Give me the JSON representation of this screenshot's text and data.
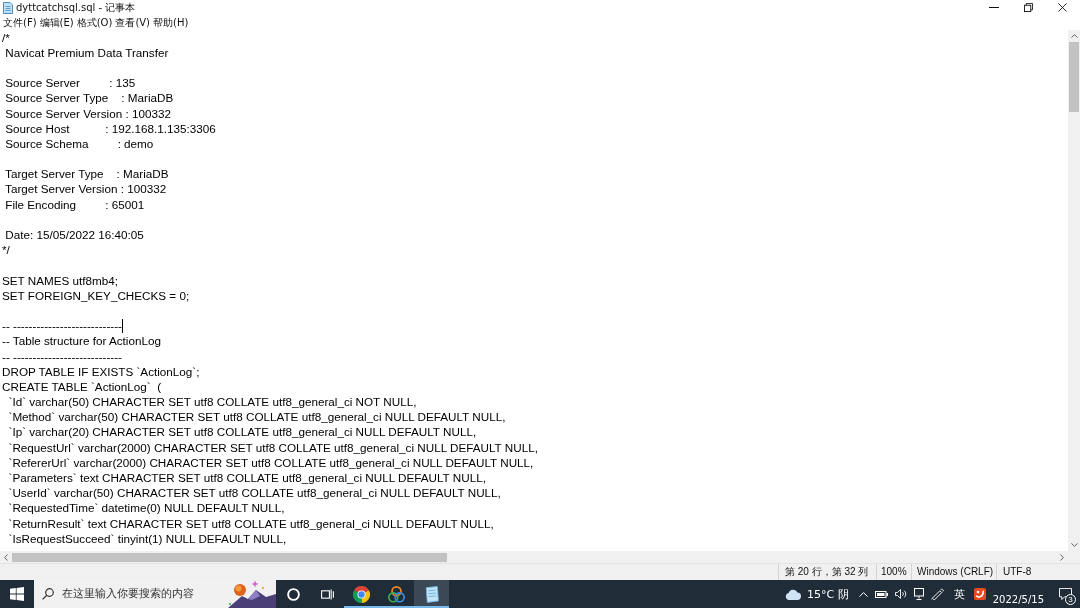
{
  "window": {
    "title": "dyttcatchsql.sql - 记事本"
  },
  "menu": [
    "文件(F)",
    "编辑(E)",
    "格式(O)",
    "查看(V)",
    "帮助(H)"
  ],
  "document": {
    "blocks": [
      {
        "lines": [
          {
            "text": "/*",
            "caret": false
          },
          {
            "text": " Navicat Premium Data Transfer",
            "caret": false
          }
        ]
      },
      {
        "lines": [
          {
            "text": " Source Server         : 135",
            "caret": false
          },
          {
            "text": " Source Server Type    : MariaDB",
            "caret": false
          },
          {
            "text": " Source Server Version : 100332",
            "caret": false
          },
          {
            "text": " Source Host           : 192.168.1.135:3306",
            "caret": false
          },
          {
            "text": " Source Schema         : demo",
            "caret": false
          }
        ]
      },
      {
        "lines": [
          {
            "text": " Target Server Type    : MariaDB",
            "caret": false
          },
          {
            "text": " Target Server Version : 100332",
            "caret": false
          },
          {
            "text": " File Encoding         : 65001",
            "caret": false
          }
        ]
      },
      {
        "lines": [
          {
            "text": " Date: 15/05/2022 16:40:05",
            "caret": false
          },
          {
            "text": "*/",
            "caret": false
          }
        ]
      },
      {
        "lines": [
          {
            "text": "SET NAMES utf8mb4;",
            "caret": false
          },
          {
            "text": "SET FOREIGN_KEY_CHECKS = 0;",
            "caret": false
          }
        ]
      },
      {
        "lines": [
          {
            "text": "-- ----------------------------",
            "caret": true
          },
          {
            "text": "-- Table structure for ActionLog",
            "caret": false
          },
          {
            "text": "-- ----------------------------",
            "caret": false
          },
          {
            "text": "DROP TABLE IF EXISTS `ActionLog`;",
            "caret": false
          },
          {
            "text": "CREATE TABLE `ActionLog`  (",
            "caret": false
          },
          {
            "text": "  `Id` varchar(50) CHARACTER SET utf8 COLLATE utf8_general_ci NOT NULL,",
            "caret": false
          },
          {
            "text": "  `Method` varchar(50) CHARACTER SET utf8 COLLATE utf8_general_ci NULL DEFAULT NULL,",
            "caret": false
          },
          {
            "text": "  `Ip` varchar(20) CHARACTER SET utf8 COLLATE utf8_general_ci NULL DEFAULT NULL,",
            "caret": false
          },
          {
            "text": "  `RequestUrl` varchar(2000) CHARACTER SET utf8 COLLATE utf8_general_ci NULL DEFAULT NULL,",
            "caret": false
          },
          {
            "text": "  `RefererUrl` varchar(2000) CHARACTER SET utf8 COLLATE utf8_general_ci NULL DEFAULT NULL,",
            "caret": false
          },
          {
            "text": "  `Parameters` text CHARACTER SET utf8 COLLATE utf8_general_ci NULL DEFAULT NULL,",
            "caret": false
          },
          {
            "text": "  `UserId` varchar(50) CHARACTER SET utf8 COLLATE utf8_general_ci NULL DEFAULT NULL,",
            "caret": false
          },
          {
            "text": "  `RequestedTime` datetime(0) NULL DEFAULT NULL,",
            "caret": false
          },
          {
            "text": "  `ReturnResult` text CHARACTER SET utf8 COLLATE utf8_general_ci NULL DEFAULT NULL,",
            "caret": false
          },
          {
            "text": "  `IsRequestSucceed` tinyint(1) NULL DEFAULT NULL,",
            "caret": false
          }
        ]
      }
    ]
  },
  "status_bar": {
    "position": "第 20 行，第 32 列",
    "zoom": "100%",
    "line_ending": "Windows (CRLF)",
    "encoding": "UTF-8"
  },
  "taskbar": {
    "search": {
      "placeholder": "在这里输入你要搜索的内容"
    },
    "apps": [
      {
        "kind": "browser",
        "running": true,
        "selected": false
      },
      {
        "kind": "rings",
        "running": true,
        "selected": false
      },
      {
        "kind": "notepad",
        "running": true,
        "selected": true
      }
    ],
    "weather": "15°C 阴",
    "input_language": "英",
    "date": "2022/5/15",
    "notification_count": "3"
  }
}
